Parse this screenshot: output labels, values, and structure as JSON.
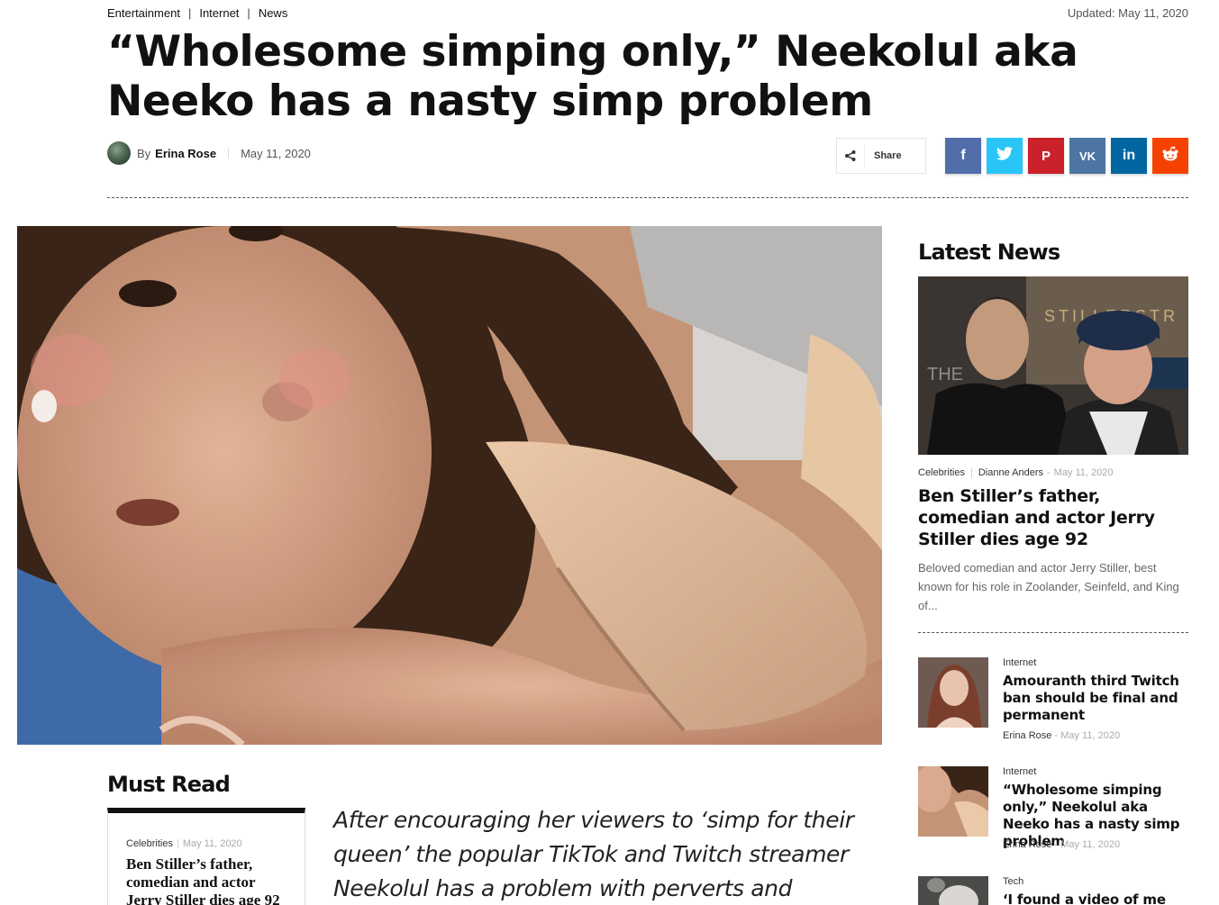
{
  "breadcrumbs": [
    "Entertainment",
    "Internet",
    "News"
  ],
  "updated": "Updated: May 11, 2020",
  "article": {
    "title": "“Wholesome simping only,” Neekolul aka Neeko has a nasty simp problem",
    "by": "By",
    "author": "Erina Rose",
    "date": "May 11, 2020",
    "lede": "After encouraging her viewers to ‘simp for their queen’ the popular TikTok and Twitch streamer Neekolul has a problem with perverts and weirdos."
  },
  "share": {
    "label": "Share",
    "networks": [
      {
        "name": "facebook",
        "glyph": "f",
        "color": "#516eab"
      },
      {
        "name": "twitter",
        "glyph": "🐦",
        "color": "#29c5f6"
      },
      {
        "name": "pinterest",
        "glyph": "P",
        "color": "#ca212a"
      },
      {
        "name": "vk",
        "glyph": "VK",
        "color": "#4c75a3"
      },
      {
        "name": "linkedin",
        "glyph": "in",
        "color": "#0266a0"
      },
      {
        "name": "reddit",
        "glyph": "◉",
        "color": "#f54200"
      }
    ]
  },
  "sidebar": {
    "title": "Latest News",
    "featured": {
      "category": "Celebrities",
      "author": "Dianne Anders",
      "date": "May 11, 2020",
      "title": "Ben Stiller’s father, comedian and actor Jerry Stiller dies age 92",
      "excerpt": "Beloved comedian and actor Jerry Stiller, best known for his role in Zoolander, Seinfeld, and King of...",
      "image_text": "STILLERSTR",
      "image_text_2": "THE"
    },
    "items": [
      {
        "category": "Internet",
        "title": "Amouranth third Twitch ban should be final and permanent",
        "author": "Erina Rose",
        "date": "May 11, 2020"
      },
      {
        "category": "Internet",
        "title": "“Wholesome simping only,” Neekolul aka Neeko has a nasty simp problem",
        "author": "Erina Rose",
        "date": "May 11, 2020"
      },
      {
        "category": "Tech",
        "title": "‘I found a video of me"
      }
    ]
  },
  "must_read": {
    "title": "Must Read",
    "card": {
      "category": "Celebrities",
      "date": "May 11, 2020",
      "title": "Ben Stiller’s father, comedian and actor Jerry Stiller dies age 92"
    }
  }
}
